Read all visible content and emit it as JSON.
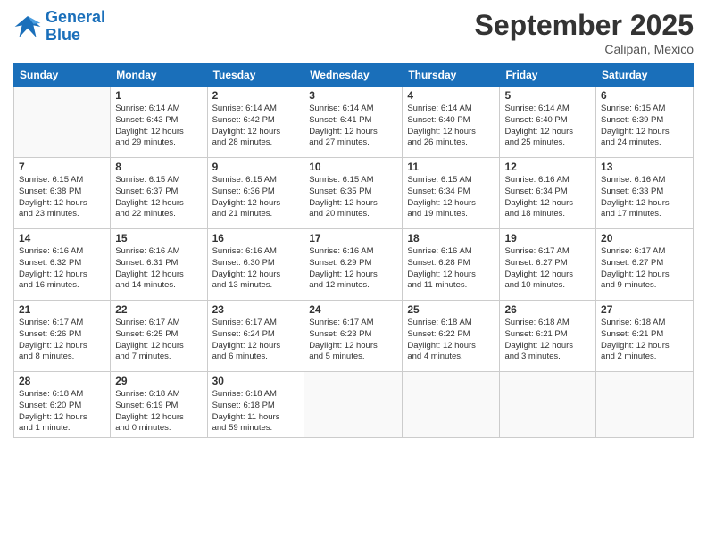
{
  "header": {
    "logo": {
      "line1": "General",
      "line2": "Blue"
    },
    "month": "September 2025",
    "location": "Calipan, Mexico"
  },
  "weekdays": [
    "Sunday",
    "Monday",
    "Tuesday",
    "Wednesday",
    "Thursday",
    "Friday",
    "Saturday"
  ],
  "weeks": [
    [
      {
        "day": "",
        "info": ""
      },
      {
        "day": "1",
        "info": "Sunrise: 6:14 AM\nSunset: 6:43 PM\nDaylight: 12 hours\nand 29 minutes."
      },
      {
        "day": "2",
        "info": "Sunrise: 6:14 AM\nSunset: 6:42 PM\nDaylight: 12 hours\nand 28 minutes."
      },
      {
        "day": "3",
        "info": "Sunrise: 6:14 AM\nSunset: 6:41 PM\nDaylight: 12 hours\nand 27 minutes."
      },
      {
        "day": "4",
        "info": "Sunrise: 6:14 AM\nSunset: 6:40 PM\nDaylight: 12 hours\nand 26 minutes."
      },
      {
        "day": "5",
        "info": "Sunrise: 6:14 AM\nSunset: 6:40 PM\nDaylight: 12 hours\nand 25 minutes."
      },
      {
        "day": "6",
        "info": "Sunrise: 6:15 AM\nSunset: 6:39 PM\nDaylight: 12 hours\nand 24 minutes."
      }
    ],
    [
      {
        "day": "7",
        "info": "Sunrise: 6:15 AM\nSunset: 6:38 PM\nDaylight: 12 hours\nand 23 minutes."
      },
      {
        "day": "8",
        "info": "Sunrise: 6:15 AM\nSunset: 6:37 PM\nDaylight: 12 hours\nand 22 minutes."
      },
      {
        "day": "9",
        "info": "Sunrise: 6:15 AM\nSunset: 6:36 PM\nDaylight: 12 hours\nand 21 minutes."
      },
      {
        "day": "10",
        "info": "Sunrise: 6:15 AM\nSunset: 6:35 PM\nDaylight: 12 hours\nand 20 minutes."
      },
      {
        "day": "11",
        "info": "Sunrise: 6:15 AM\nSunset: 6:34 PM\nDaylight: 12 hours\nand 19 minutes."
      },
      {
        "day": "12",
        "info": "Sunrise: 6:16 AM\nSunset: 6:34 PM\nDaylight: 12 hours\nand 18 minutes."
      },
      {
        "day": "13",
        "info": "Sunrise: 6:16 AM\nSunset: 6:33 PM\nDaylight: 12 hours\nand 17 minutes."
      }
    ],
    [
      {
        "day": "14",
        "info": "Sunrise: 6:16 AM\nSunset: 6:32 PM\nDaylight: 12 hours\nand 16 minutes."
      },
      {
        "day": "15",
        "info": "Sunrise: 6:16 AM\nSunset: 6:31 PM\nDaylight: 12 hours\nand 14 minutes."
      },
      {
        "day": "16",
        "info": "Sunrise: 6:16 AM\nSunset: 6:30 PM\nDaylight: 12 hours\nand 13 minutes."
      },
      {
        "day": "17",
        "info": "Sunrise: 6:16 AM\nSunset: 6:29 PM\nDaylight: 12 hours\nand 12 minutes."
      },
      {
        "day": "18",
        "info": "Sunrise: 6:16 AM\nSunset: 6:28 PM\nDaylight: 12 hours\nand 11 minutes."
      },
      {
        "day": "19",
        "info": "Sunrise: 6:17 AM\nSunset: 6:27 PM\nDaylight: 12 hours\nand 10 minutes."
      },
      {
        "day": "20",
        "info": "Sunrise: 6:17 AM\nSunset: 6:27 PM\nDaylight: 12 hours\nand 9 minutes."
      }
    ],
    [
      {
        "day": "21",
        "info": "Sunrise: 6:17 AM\nSunset: 6:26 PM\nDaylight: 12 hours\nand 8 minutes."
      },
      {
        "day": "22",
        "info": "Sunrise: 6:17 AM\nSunset: 6:25 PM\nDaylight: 12 hours\nand 7 minutes."
      },
      {
        "day": "23",
        "info": "Sunrise: 6:17 AM\nSunset: 6:24 PM\nDaylight: 12 hours\nand 6 minutes."
      },
      {
        "day": "24",
        "info": "Sunrise: 6:17 AM\nSunset: 6:23 PM\nDaylight: 12 hours\nand 5 minutes."
      },
      {
        "day": "25",
        "info": "Sunrise: 6:18 AM\nSunset: 6:22 PM\nDaylight: 12 hours\nand 4 minutes."
      },
      {
        "day": "26",
        "info": "Sunrise: 6:18 AM\nSunset: 6:21 PM\nDaylight: 12 hours\nand 3 minutes."
      },
      {
        "day": "27",
        "info": "Sunrise: 6:18 AM\nSunset: 6:21 PM\nDaylight: 12 hours\nand 2 minutes."
      }
    ],
    [
      {
        "day": "28",
        "info": "Sunrise: 6:18 AM\nSunset: 6:20 PM\nDaylight: 12 hours\nand 1 minute."
      },
      {
        "day": "29",
        "info": "Sunrise: 6:18 AM\nSunset: 6:19 PM\nDaylight: 12 hours\nand 0 minutes."
      },
      {
        "day": "30",
        "info": "Sunrise: 6:18 AM\nSunset: 6:18 PM\nDaylight: 11 hours\nand 59 minutes."
      },
      {
        "day": "",
        "info": ""
      },
      {
        "day": "",
        "info": ""
      },
      {
        "day": "",
        "info": ""
      },
      {
        "day": "",
        "info": ""
      }
    ]
  ]
}
